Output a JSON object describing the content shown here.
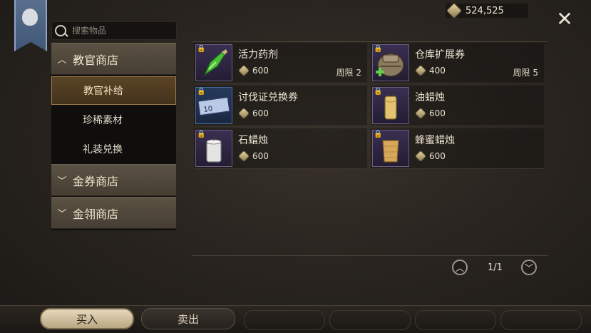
{
  "currency": {
    "amount": "524,525",
    "icon": "gem-coin-icon"
  },
  "search": {
    "placeholder": "搜索物品"
  },
  "sidebar": {
    "categories": [
      {
        "label": "教官商店",
        "expanded": true
      },
      {
        "label": "金券商店",
        "expanded": false
      },
      {
        "label": "金翎商店",
        "expanded": false
      }
    ],
    "subitems": [
      {
        "label": "教官补给",
        "active": true
      },
      {
        "label": "珍稀素材",
        "active": false
      },
      {
        "label": "礼装兑换",
        "active": false
      }
    ]
  },
  "items": [
    {
      "name": "活力药剂",
      "price": "600",
      "limit": "周限 2",
      "icon": "potion-icon"
    },
    {
      "name": "仓库扩展券",
      "price": "400",
      "limit": "周限 5",
      "icon": "backpack-icon"
    },
    {
      "name": "讨伐证兑换券",
      "price": "600",
      "limit": "",
      "icon": "ticket-icon"
    },
    {
      "name": "油蜡烛",
      "price": "600",
      "limit": "",
      "icon": "candle-icon"
    },
    {
      "name": "石蜡烛",
      "price": "600",
      "limit": "",
      "icon": "candle-icon"
    },
    {
      "name": "蜂蜜蜡烛",
      "price": "600",
      "limit": "",
      "icon": "candle-icon"
    }
  ],
  "ticket_badge": "10",
  "pagination": {
    "current": "1/1"
  },
  "footer": {
    "buy_label": "买入",
    "sell_label": "卖出"
  }
}
